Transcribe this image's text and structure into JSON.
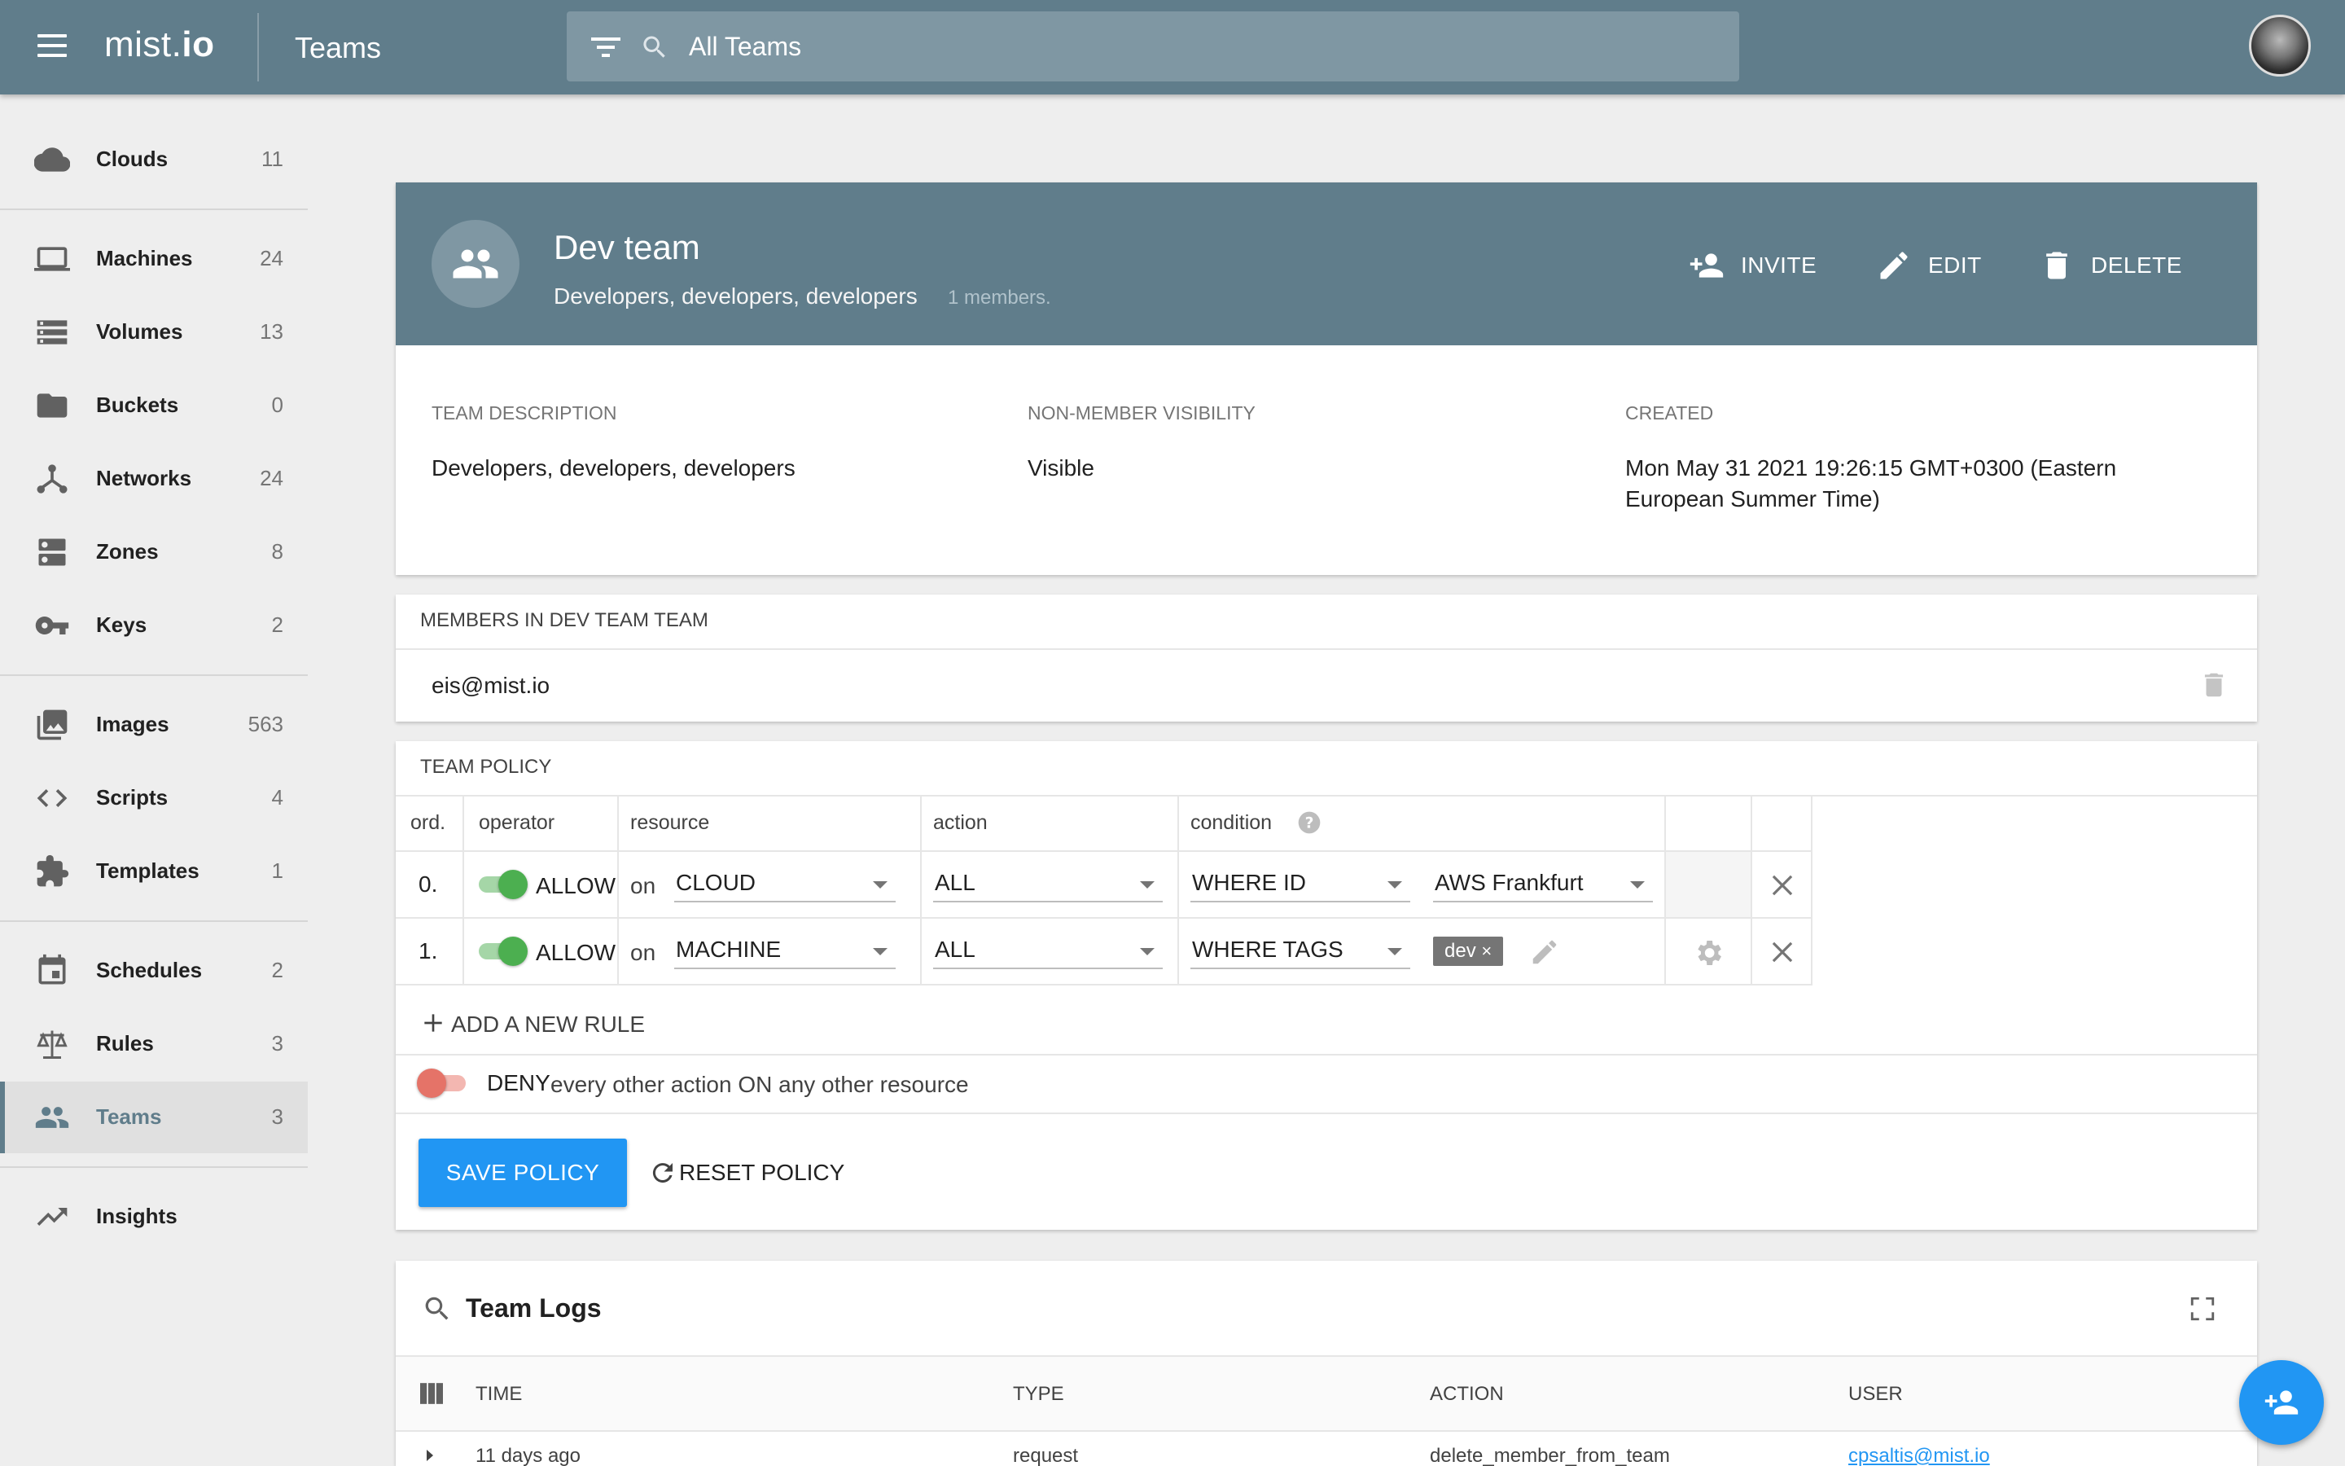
{
  "header": {
    "logo_prefix": "mist.",
    "logo_suffix": "io",
    "section": "Teams",
    "search_placeholder": "All Teams"
  },
  "sidebar": {
    "items": [
      {
        "label": "Clouds",
        "count": "11",
        "icon": "cloud-icon"
      },
      {
        "label": "Machines",
        "count": "24",
        "icon": "laptop-icon"
      },
      {
        "label": "Volumes",
        "count": "13",
        "icon": "storage-icon"
      },
      {
        "label": "Buckets",
        "count": "0",
        "icon": "folder-icon"
      },
      {
        "label": "Networks",
        "count": "24",
        "icon": "network-icon"
      },
      {
        "label": "Zones",
        "count": "8",
        "icon": "dns-icon"
      },
      {
        "label": "Keys",
        "count": "2",
        "icon": "key-icon"
      },
      {
        "label": "Images",
        "count": "563",
        "icon": "image-icon"
      },
      {
        "label": "Scripts",
        "count": "4",
        "icon": "code-icon"
      },
      {
        "label": "Templates",
        "count": "1",
        "icon": "puzzle-icon"
      },
      {
        "label": "Schedules",
        "count": "2",
        "icon": "calendar-icon"
      },
      {
        "label": "Rules",
        "count": "3",
        "icon": "scale-icon"
      },
      {
        "label": "Teams",
        "count": "3",
        "icon": "people-icon",
        "active": true
      },
      {
        "label": "Insights",
        "count": "",
        "icon": "trending-icon"
      }
    ]
  },
  "team": {
    "name": "Dev team",
    "description": "Developers, developers, developers",
    "members_count": "1 members.",
    "actions": {
      "invite": "INVITE",
      "edit": "EDIT",
      "delete": "DELETE"
    },
    "info": {
      "description_label": "TEAM DESCRIPTION",
      "description_value": "Developers, developers, developers",
      "visibility_label": "NON-MEMBER VISIBILITY",
      "visibility_value": "Visible",
      "created_label": "CREATED",
      "created_value_line1": "Mon May 31 2021 19:26:15 GMT+0300 (Eastern",
      "created_value_line2": "European Summer Time)"
    }
  },
  "members": {
    "title": "MEMBERS IN DEV TEAM TEAM",
    "list": [
      "eis@mist.io"
    ]
  },
  "policy": {
    "title": "TEAM POLICY",
    "columns": {
      "ord": "ord.",
      "operator": "operator",
      "resource": "resource",
      "action": "action",
      "condition": "condition"
    },
    "rules": [
      {
        "ord": "0.",
        "operator": "ALLOW",
        "on": "on",
        "resource": "CLOUD",
        "action": "ALL",
        "condition": "WHERE ID",
        "value": "AWS Frankfurt"
      },
      {
        "ord": "1.",
        "operator": "ALLOW",
        "on": "on",
        "resource": "MACHINE",
        "action": "ALL",
        "condition": "WHERE TAGS",
        "tag": "dev"
      }
    ],
    "add_rule": "ADD A NEW RULE",
    "deny_label": "DENY",
    "deny_text": "every other action ON any other resource",
    "save": "SAVE POLICY",
    "reset": "RESET POLICY"
  },
  "logs": {
    "title": "Team Logs",
    "columns": {
      "time": "TIME",
      "type": "TYPE",
      "action": "ACTION",
      "user": "USER"
    },
    "rows": [
      {
        "time": "11 days ago",
        "type": "request",
        "action": "delete_member_from_team",
        "user": "cpsaltis@mist.io"
      }
    ]
  },
  "colors": {
    "primary": "#607d8b",
    "accent": "#2196f3",
    "allow_green": "#4caf50",
    "deny_red": "#e57368"
  }
}
